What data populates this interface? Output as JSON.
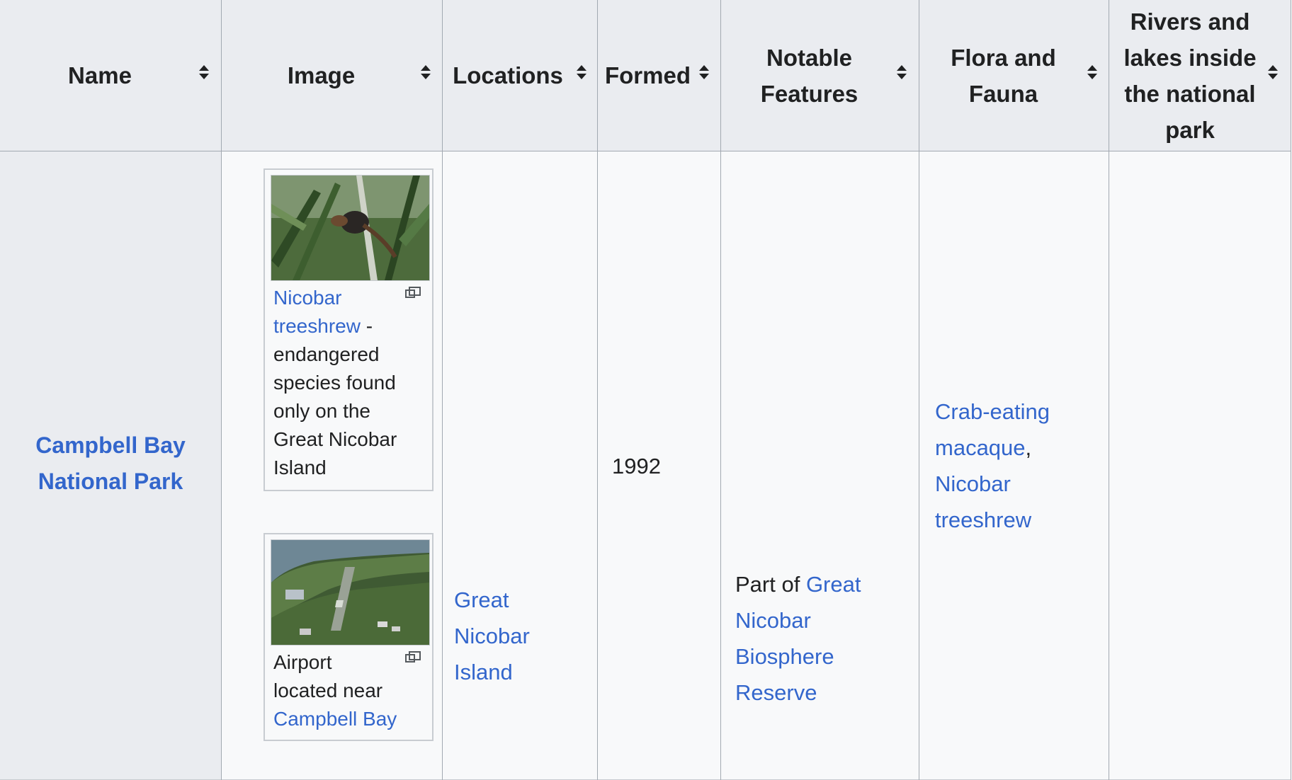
{
  "table": {
    "headers": {
      "name": "Name",
      "image": "Image",
      "locations": "Locations",
      "formed": "Formed",
      "notable_1": "Notable",
      "notable_2": "Features",
      "flora_1": "Flora and",
      "flora_2": "Fauna",
      "rivers_1": "Rivers and",
      "rivers_2": "lakes inside",
      "rivers_3": "the national",
      "rivers_4": "park"
    },
    "row": {
      "name_1": "Campbell Bay",
      "name_2": "National Park",
      "image1": {
        "caption_link_1": "Nicobar",
        "caption_link_2": "treeshrew",
        "caption_rest_1": " -",
        "caption_rest_2": "endangered",
        "caption_rest_3": "species found",
        "caption_rest_4": "only on the",
        "caption_rest_5": "Great Nicobar",
        "caption_rest_6": "Island"
      },
      "image2": {
        "caption_1": "Airport",
        "caption_2": "located near",
        "caption_link": "Campbell Bay"
      },
      "location_1": "Great",
      "location_2": "Nicobar",
      "location_3": "Island",
      "formed": "1992",
      "notable_prefix": "Part of ",
      "notable_link_1": "Great",
      "notable_link_2": "Nicobar",
      "notable_link_3": "Biosphere",
      "notable_link_4": "Reserve",
      "flora_link_1a": "Crab-eating",
      "flora_link_1b": "macaque",
      "flora_comma": ",",
      "flora_link_2a": "Nicobar",
      "flora_link_2b": "treeshrew",
      "rivers": ""
    }
  },
  "colors": {
    "header_bg": "#eaecf0",
    "cell_bg": "#f8f9fa",
    "link": "#3366cc",
    "border": "#a2a9b1"
  }
}
